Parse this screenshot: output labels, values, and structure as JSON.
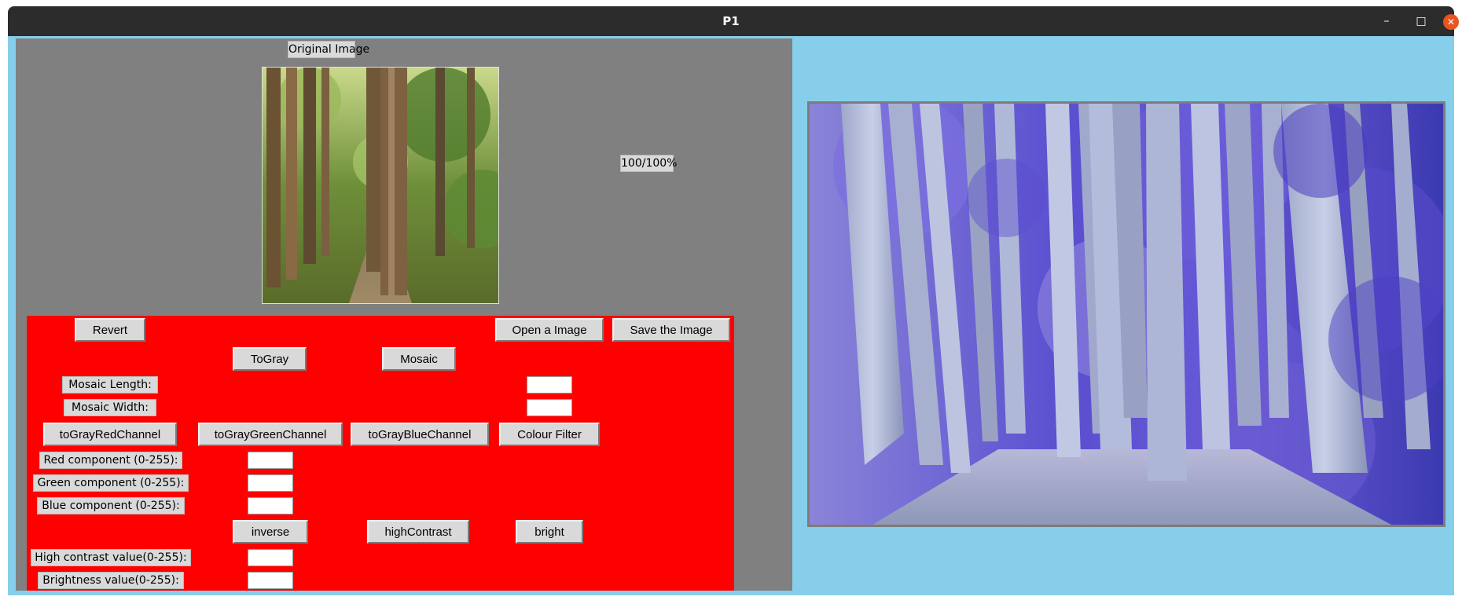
{
  "window": {
    "title": "P1",
    "minimize_glyph": "–",
    "maximize_glyph": "□",
    "close_glyph": "✕"
  },
  "left": {
    "original_label": "Original Image",
    "zoom_label": "100/100%"
  },
  "controls": {
    "revert": "Revert",
    "open_image": "Open a Image",
    "save_image": "Save the Image",
    "to_gray": "ToGray",
    "mosaic": "Mosaic",
    "mosaic_length_label": "Mosaic Length:",
    "mosaic_length_value": "",
    "mosaic_width_label": "Mosaic Width:",
    "mosaic_width_value": "",
    "to_gray_red": "toGrayRedChannel",
    "to_gray_green": "toGrayGreenChannel",
    "to_gray_blue": "toGrayBlueChannel",
    "colour_filter": "Colour Filter",
    "red_label": "Red component (0-255):",
    "red_value": "",
    "green_label": "Green component (0-255):",
    "green_value": "",
    "blue_label": "Blue component (0-255):",
    "blue_value": "",
    "inverse": "inverse",
    "high_contrast": "highContrast",
    "bright": "bright",
    "high_contrast_label": "High contrast value(0-255):",
    "high_contrast_value": "",
    "brightness_label": "Brightness value(0-255):",
    "brightness_value": ""
  },
  "colors": {
    "titlebar": "#2c2c2c",
    "window_bg": "#87ceeb",
    "left_panel_bg": "#808080",
    "controls_bg": "#ff0000",
    "widget_bg": "#d9d9d9",
    "close_button": "#e95420"
  }
}
